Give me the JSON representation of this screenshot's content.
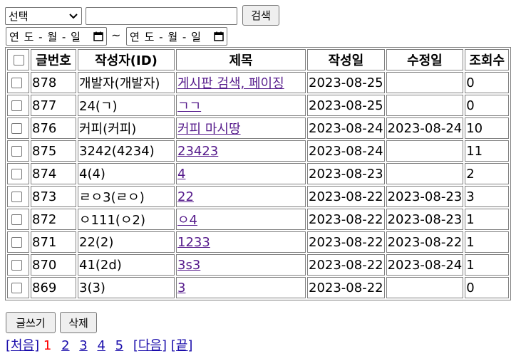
{
  "search": {
    "select_value": "선택",
    "input_value": "",
    "button_label": "검색"
  },
  "date_range": {
    "from_placeholder": "연 도 - 월 - 일",
    "to_placeholder": "연 도 - 월 - 일",
    "separator": "~"
  },
  "table": {
    "headers": [
      "글번호",
      "작성자(ID)",
      "제목",
      "작성일",
      "수정일",
      "조회수"
    ],
    "rows": [
      {
        "no": "878",
        "author": "개발자(개발자)",
        "title": "게시판 검색, 페이징",
        "created": "2023-08-25",
        "modified": "",
        "views": "0"
      },
      {
        "no": "877",
        "author": "24(ㄱ)",
        "title": "ㄱㄱ",
        "created": "2023-08-25",
        "modified": "",
        "views": "0"
      },
      {
        "no": "876",
        "author": "커피(커피)",
        "title": "커피 마시땅",
        "created": "2023-08-24",
        "modified": "2023-08-24",
        "views": "10"
      },
      {
        "no": "875",
        "author": "3242(4234)",
        "title": "23423",
        "created": "2023-08-24",
        "modified": "",
        "views": "11"
      },
      {
        "no": "874",
        "author": "4(4)",
        "title": "4",
        "created": "2023-08-23",
        "modified": "",
        "views": "2"
      },
      {
        "no": "873",
        "author": "ㄹㅇ3(ㄹㅇ)",
        "title": "22",
        "created": "2023-08-22",
        "modified": "2023-08-23",
        "views": "3"
      },
      {
        "no": "872",
        "author": "ㅇ111(ㅇ2)",
        "title": "ㅇ4",
        "created": "2023-08-22",
        "modified": "2023-08-23",
        "views": "1"
      },
      {
        "no": "871",
        "author": "22(2)",
        "title": "1233",
        "created": "2023-08-22",
        "modified": "2023-08-22",
        "views": "1"
      },
      {
        "no": "870",
        "author": "41(2d)",
        "title": "3s3",
        "created": "2023-08-22",
        "modified": "2023-08-24",
        "views": "1"
      },
      {
        "no": "869",
        "author": "3(3)",
        "title": "3",
        "created": "2023-08-22",
        "modified": "",
        "views": "0"
      }
    ]
  },
  "actions": {
    "write_label": "글쓰기",
    "delete_label": "삭제"
  },
  "pagination": {
    "first": "[처음]",
    "current": "1",
    "pages": [
      "2",
      "3",
      "4",
      "5"
    ],
    "next": "[다음]",
    "last": "[끝]"
  },
  "colors": {
    "link_visited": "#551a8b",
    "link": "#1a0dab",
    "current_page": "#ff0000"
  }
}
